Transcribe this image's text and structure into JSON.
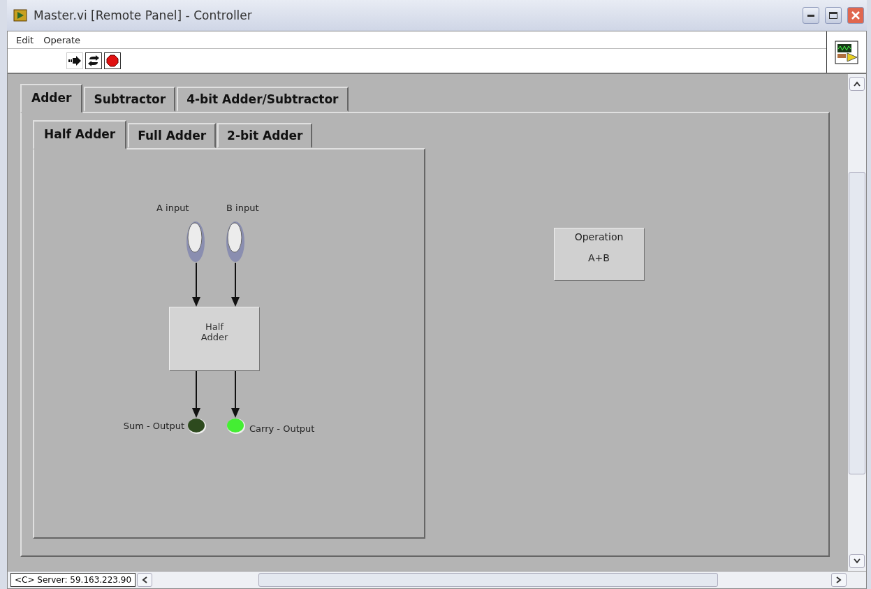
{
  "window": {
    "title": "Master.vi [Remote Panel] - Controller"
  },
  "menu": [
    "Edit",
    "Operate"
  ],
  "tabs": [
    {
      "label": "Adder",
      "selected": true
    },
    {
      "label": "Subtractor",
      "selected": false
    },
    {
      "label": "4-bit Adder/Subtractor",
      "selected": false
    }
  ],
  "subtabs": [
    {
      "label": "Half Adder",
      "selected": true
    },
    {
      "label": "Full Adder",
      "selected": false
    },
    {
      "label": "2-bit Adder",
      "selected": false
    }
  ],
  "diagram": {
    "block": "Half Adder",
    "inputs": [
      {
        "label": "A input",
        "on": false
      },
      {
        "label": "B input",
        "on": false
      }
    ],
    "outputs": [
      {
        "label": "Sum - Output",
        "on": false
      },
      {
        "label": "Carry - Output",
        "on": true
      }
    ]
  },
  "operation": {
    "title": "Operation",
    "value": "A+B"
  },
  "status_bar": {
    "server": "<C> Server: 59.163.223.90"
  }
}
